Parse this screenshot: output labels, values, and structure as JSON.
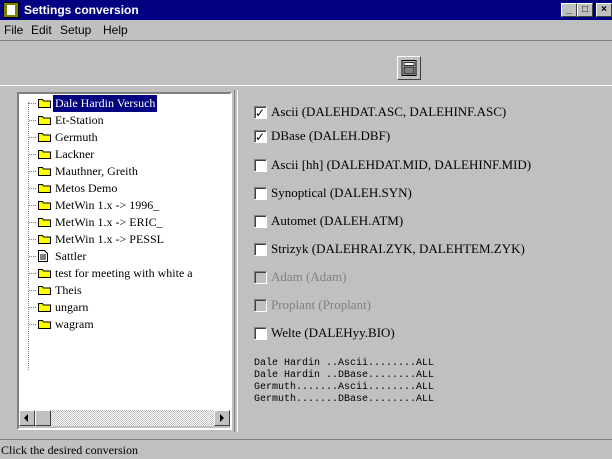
{
  "window": {
    "title": "Settings conversion",
    "controls": [
      "_",
      "□",
      "×"
    ]
  },
  "menu": [
    "File",
    "Edit",
    "Setup",
    "Help"
  ],
  "toolbar": {
    "icon": "calculator-icon"
  },
  "tree": {
    "items": [
      {
        "label": "Dale Hardin Versuch",
        "icon": "folder-icon",
        "selected": true
      },
      {
        "label": "Et-Station",
        "icon": "folder-icon"
      },
      {
        "label": "Germuth",
        "icon": "folder-icon"
      },
      {
        "label": "Lackner",
        "icon": "folder-icon"
      },
      {
        "label": "Mauthner, Greith",
        "icon": "folder-icon"
      },
      {
        "label": "Metos Demo",
        "icon": "folder-icon"
      },
      {
        "label": "MetWin 1.x -> 1996_",
        "icon": "folder-icon"
      },
      {
        "label": "MetWin 1.x -> ERIC_",
        "icon": "folder-icon"
      },
      {
        "label": "MetWin 1.x -> PESSL",
        "icon": "folder-icon"
      },
      {
        "label": "Sattler",
        "icon": "document-icon"
      },
      {
        "label": "test for meeting with white a",
        "icon": "folder-icon"
      },
      {
        "label": "Theis",
        "icon": "folder-icon"
      },
      {
        "label": "ungarn",
        "icon": "folder-icon"
      },
      {
        "label": "wagram",
        "icon": "folder-icon"
      }
    ]
  },
  "options": [
    {
      "label": "Ascii (DALEHDAT.ASC, DALEHINF.ASC)",
      "checked": true,
      "enabled": true
    },
    {
      "label": "DBase (DALEH.DBF)",
      "checked": true,
      "enabled": true
    },
    {
      "label": "Ascii [hh] (DALEHDAT.MID, DALEHINF.MID)",
      "checked": false,
      "enabled": true
    },
    {
      "label": "Synoptical (DALEH.SYN)",
      "checked": false,
      "enabled": true
    },
    {
      "label": "Automet (DALEH.ATM)",
      "checked": false,
      "enabled": true
    },
    {
      "label": "Strizyk (DALEHRAI.ZYK, DALEHTEM.ZYK)",
      "checked": false,
      "enabled": true
    },
    {
      "label": "Adam (Adam)",
      "checked": false,
      "enabled": false
    },
    {
      "label": "Proplant (Proplant)",
      "checked": false,
      "enabled": false
    },
    {
      "label": "Welte (DALEHyy.BIO)",
      "checked": false,
      "enabled": true
    }
  ],
  "summary": [
    "Dale Hardin ..Ascii........ALL",
    "Dale Hardin ..DBase........ALL",
    "Germuth.......Ascii........ALL",
    "Germuth.......DBase........ALL"
  ],
  "status": "Click the desired conversion"
}
